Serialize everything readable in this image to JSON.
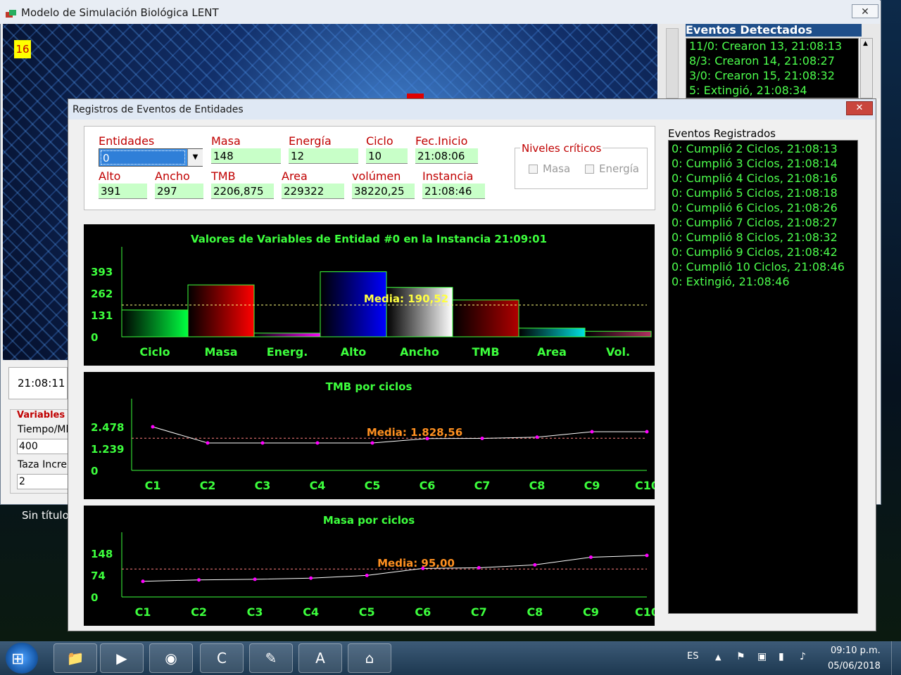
{
  "main_window": {
    "title": "Modelo de Simulación Biológica LENT",
    "counter": "16",
    "clock": "21:08:11",
    "vars_legend": "Variables i",
    "tiempo_label": "Tiempo/Ml",
    "tiempo_value": "400",
    "taza_label": "Taza Incre",
    "taza_value": "2",
    "close_icon": "close-icon"
  },
  "events_detected": {
    "title": "Eventos Detectados",
    "items": [
      "11/0: Crearon 13, 21:08:13",
      "8/3: Crearon 14, 21:08:27",
      "3/0: Crearon 15, 21:08:32",
      "5: Extingió, 21:08:34"
    ]
  },
  "desktop": {
    "sin_titulo": "Sin título"
  },
  "dialog": {
    "title": "Registros de Eventos de Entidades",
    "fields": {
      "entidades_label": "Entidades",
      "entidades_value": "0",
      "masa_label": "Masa",
      "masa_value": "148",
      "energia_label": "Energía",
      "energia_value": "12",
      "ciclo_label": "Ciclo",
      "ciclo_value": "10",
      "fecinicio_label": "Fec.Inicio",
      "fecinicio_value": "21:08:06",
      "alto_label": "Alto",
      "alto_value": "391",
      "ancho_label": "Ancho",
      "ancho_value": "297",
      "tmb_label": "TMB",
      "tmb_value": "2206,875",
      "area_label": "Area",
      "area_value": "229322",
      "volumen_label": "volúmen",
      "volumen_value": "38220,25",
      "instancia_label": "Instancia",
      "instancia_value": "21:08:46"
    },
    "niveles": {
      "legend": "Niveles críticos",
      "masa": "Masa",
      "energia": "Energía"
    },
    "registered": {
      "title": "Eventos Registrados",
      "items": [
        "0: Cumplió 2 Ciclos, 21:08:13",
        "0: Cumplió 3 Ciclos, 21:08:14",
        "0: Cumplió 4 Ciclos, 21:08:16",
        "0: Cumplió 5 Ciclos, 21:08:18",
        "0: Cumplió 6 Ciclos, 21:08:26",
        "0: Cumplió 7 Ciclos, 21:08:27",
        "0: Cumplió 8 Ciclos, 21:08:32",
        "0: Cumplió 9 Ciclos, 21:08:42",
        "0: Cumplió 10 Ciclos, 21:08:46",
        "0: Extingió, 21:08:46"
      ]
    }
  },
  "taskbar": {
    "lang": "ES",
    "time": "09:10 p.m.",
    "date": "05/06/2018",
    "apps": [
      "file-explorer-icon",
      "media-player-icon",
      "chrome-icon",
      "ccleaner-icon",
      "notepad-icon",
      "wordpad-icon",
      "lent-app-icon"
    ]
  },
  "chart_data": [
    {
      "type": "bar",
      "title": "Valores de Variables de Entidad #0 en la Instancia 21:09:01",
      "categories": [
        "Ciclo",
        "Masa",
        "Energ.",
        "Alto",
        "Ancho",
        "TMB",
        "Area",
        "Vol."
      ],
      "values": [
        161,
        312,
        22,
        391,
        297,
        221,
        52,
        33
      ],
      "yticks": [
        "0",
        "131",
        "262",
        "393"
      ],
      "ylim": [
        0,
        393
      ],
      "mean_label": "Media: 190,52",
      "mean": 190.52,
      "colors": [
        "#00ff40",
        "#ff0000",
        "#ff00ff",
        "#0000ff",
        "#ffffff",
        "#b00000",
        "#00e0e0",
        "#b03060"
      ]
    },
    {
      "type": "line",
      "title": "TMB por ciclos",
      "categories": [
        "C1",
        "C2",
        "C3",
        "C4",
        "C5",
        "C6",
        "C7",
        "C8",
        "C9",
        "C10"
      ],
      "values": [
        2478,
        1560,
        1560,
        1560,
        1560,
        1810,
        1820,
        1890,
        2200,
        2200
      ],
      "yticks": [
        "0",
        "1.239",
        "2.478"
      ],
      "ylim": [
        0,
        2478
      ],
      "mean_label": "Media: 1.828,56",
      "mean": 1828.56
    },
    {
      "type": "line",
      "title": "Masa por ciclos",
      "categories": [
        "C1",
        "C2",
        "C3",
        "C4",
        "C5",
        "C6",
        "C7",
        "C8",
        "C9",
        "C10"
      ],
      "values": [
        53,
        58,
        60,
        64,
        73,
        97,
        99,
        109,
        135,
        141
      ],
      "yticks": [
        "0",
        "74",
        "148"
      ],
      "ylim": [
        0,
        148
      ],
      "mean_label": "Media: 95,00",
      "mean": 95.0
    }
  ]
}
